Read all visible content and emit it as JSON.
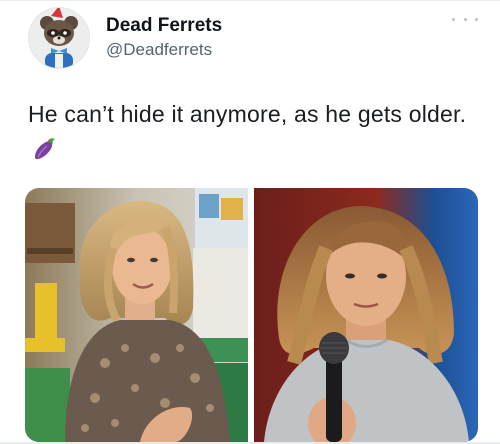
{
  "tweet": {
    "author": {
      "display_name": "Dead Ferrets",
      "handle": "@Deadferrets",
      "avatar": "ferret-avatar"
    },
    "text": "He can’t hide it anymore, as he gets older.",
    "emoji": "eggplant-emoji",
    "more_icon": "more-options-icon",
    "media": [
      {
        "name": "photo-left",
        "description_icon": "photo"
      },
      {
        "name": "photo-right",
        "description_icon": "photo"
      }
    ]
  },
  "colors": {
    "text": "#0f1419",
    "secondary": "#536471",
    "eggplant": "#7b3fa0"
  }
}
